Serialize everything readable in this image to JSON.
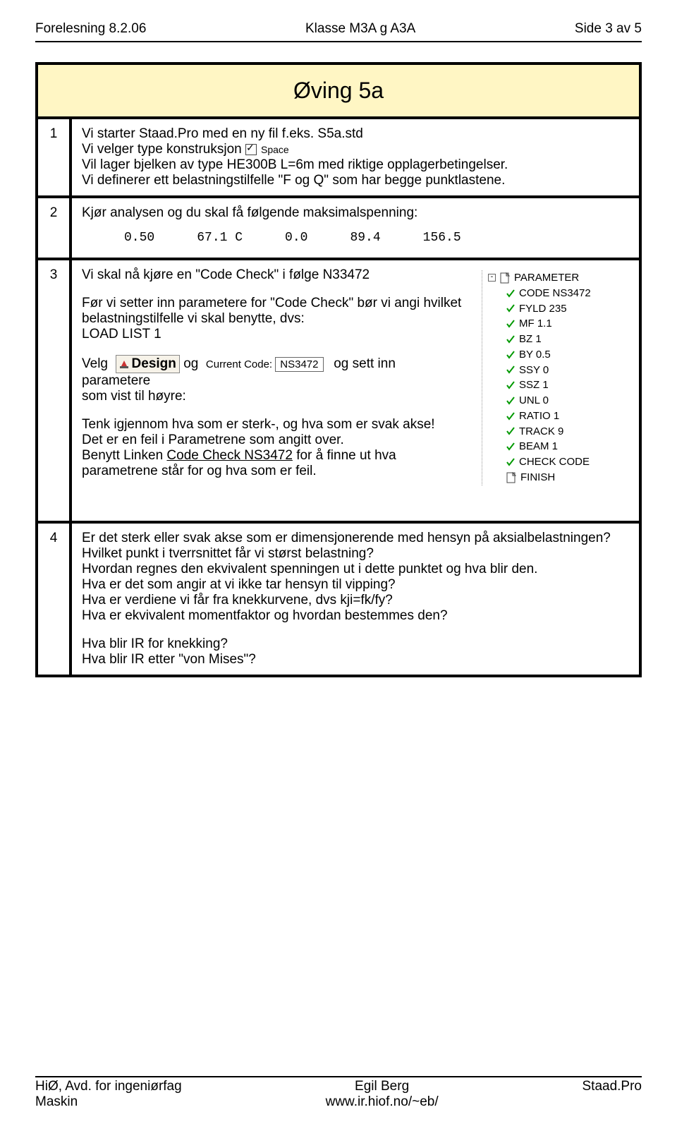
{
  "header": {
    "left": "Forelesning 8.2.06",
    "mid": "Klasse M3A g A3A",
    "right": "Side 3 av 5"
  },
  "title": "Øving 5a",
  "row1": {
    "num": "1",
    "l1a": "Vi starter Staad.Pro med en ny fil f.eks. S5a.std",
    "l2a": "Vi velger type konstruksjon ",
    "space_label": "Space",
    "l3": "Vil lager bjelken av type HE300B L=6m med riktige opplagerbetingelser.",
    "l4": "Vi definerer ett belastningstilfelle \"F og Q\" som har begge punktlastene."
  },
  "row2": {
    "num": "2",
    "l1": "Kjør analysen og du skal få følgende maksimalspenning:",
    "out": {
      "a": "0.50",
      "b": "67.1 C",
      "c": "0.0",
      "d": "89.4",
      "e": "156.5"
    }
  },
  "row3": {
    "num": "3",
    "l1": "Vi skal nå kjøre en \"Code Check\" i følge N33472",
    "l2": "Før vi setter inn parametere for \"Code Check\" bør vi angi hvilket belastningstilfelle vi skal benytte, dvs:",
    "l3": "LOAD LIST 1",
    "velg": "Velg",
    "design_label": "Design",
    "og": "og",
    "current_code_lbl": "Current Code:",
    "current_code_val": "NS3472",
    "tail": "og sett inn parametere",
    "l5": "som vist til høyre:",
    "p1": "Tenk igjennom hva som er sterk-, og hva som er svak akse!",
    "p2": " Det er en feil i Parametrene som angitt over.",
    "p3a": " Benytt Linken ",
    "link": "Code Check NS3472",
    "p3b": " for å finne ut hva parametrene står for og hva som er feil.",
    "tree_root": "PARAMETER",
    "tree_items": [
      "CODE NS3472",
      "FYLD 235",
      "MF 1.1",
      "BZ 1",
      "BY 0.5",
      "SSY 0",
      "SSZ 1",
      "UNL 0",
      "RATIO 1",
      "TRACK 9",
      "BEAM 1",
      "CHECK CODE",
      "FINISH"
    ]
  },
  "row4": {
    "num": "4",
    "l1": "Er det sterk eller svak akse som er dimensjonerende med hensyn på aksialbelastningen?",
    "l2": "Hvilket punkt i tverrsnittet får vi størst belastning?",
    "l3": "Hvordan regnes den ekvivalent spenningen ut i dette punktet og hva blir den.",
    "l4": "Hva er det som angir at vi ikke tar hensyn til vipping?",
    "l5": "Hva er verdiene vi får fra knekkurvene, dvs kji=fk/fy?",
    "l6": "Hva er ekvivalent momentfaktor og hvordan bestemmes den?",
    "l7": "Hva blir IR for knekking?",
    "l8": "Hva blir IR etter \"von Mises\"?"
  },
  "footer": {
    "l_top": "HiØ, Avd. for ingeniørfag",
    "l_bot": "Maskin",
    "m_top": "Egil Berg",
    "m_bot": "www.ir.hiof.no/~eb/",
    "r": "Staad.Pro"
  }
}
